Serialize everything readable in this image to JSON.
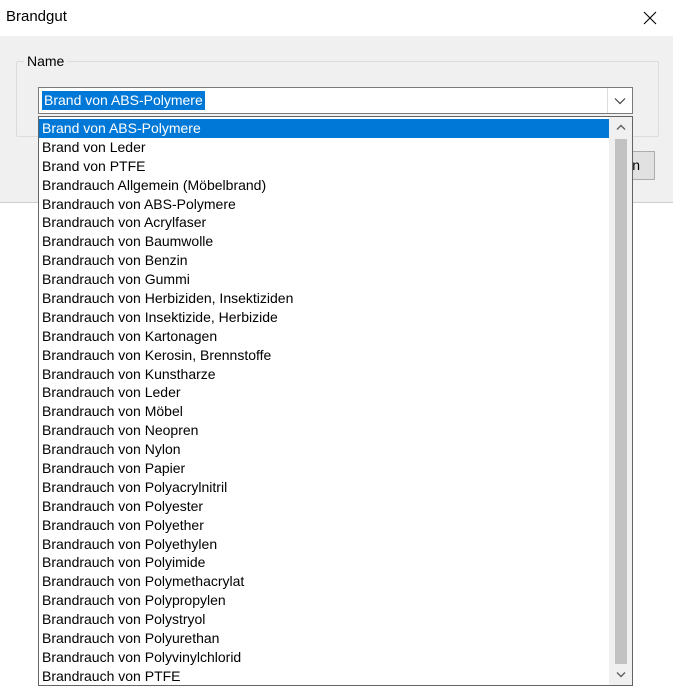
{
  "window": {
    "title": "Brandgut"
  },
  "group": {
    "label": "Name"
  },
  "combo": {
    "value": "Brand von ABS-Polymere"
  },
  "button": {
    "label": "n"
  },
  "dropdown": {
    "items": [
      "Brand von ABS-Polymere",
      "Brand von Leder",
      "Brand von PTFE",
      "Brandrauch Allgemein (Möbelbrand)",
      "Brandrauch von ABS-Polymere",
      "Brandrauch von Acrylfaser",
      "Brandrauch von Baumwolle",
      "Brandrauch von Benzin",
      "Brandrauch von Gummi",
      "Brandrauch von Herbiziden, Insektiziden",
      "Brandrauch von Insektizide, Herbizide",
      "Brandrauch von Kartonagen",
      "Brandrauch von Kerosin, Brennstoffe",
      "Brandrauch von Kunstharze",
      "Brandrauch von Leder",
      "Brandrauch von Möbel",
      "Brandrauch von Neopren",
      "Brandrauch von Nylon",
      "Brandrauch von Papier",
      "Brandrauch von Polyacrylnitril",
      "Brandrauch von Polyester",
      "Brandrauch von Polyether",
      "Brandrauch von Polyethylen",
      "Brandrauch von Polyimide",
      "Brandrauch von Polymethacrylat",
      "Brandrauch von Polypropylen",
      "Brandrauch von Polystryol",
      "Brandrauch von Polyurethan",
      "Brandrauch von Polyvinylchlorid",
      "Brandrauch von PTFE"
    ],
    "selected_index": 0
  },
  "colors": {
    "accent": "#0078d7"
  },
  "icons": {
    "close": "close-icon",
    "combo_arrow": "chevron-down-icon",
    "scroll_up": "chevron-up-icon",
    "scroll_down": "chevron-down-icon"
  }
}
